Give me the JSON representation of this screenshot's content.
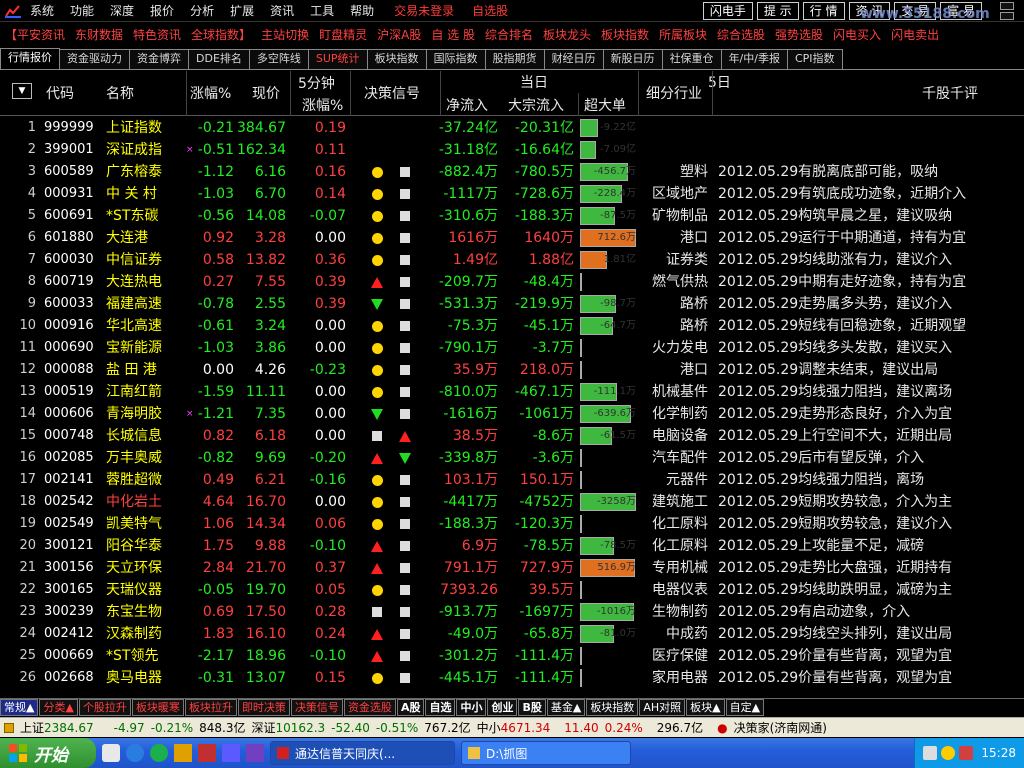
{
  "menu": {
    "items": [
      "系统",
      "功能",
      "深度",
      "报价",
      "分析",
      "扩展",
      "资讯",
      "工具",
      "帮助"
    ],
    "status_left": "交易未登录",
    "status_right": "自选股",
    "buttons": [
      "闪电手",
      "提 示",
      "行 情",
      "资 讯",
      "交 易",
      "富 易"
    ],
    "watermark": "www.55188.com"
  },
  "funcbar": [
    "【平安资讯",
    "东财数据",
    "特色资讯",
    "全球指数】",
    "主站切换",
    "盯盘精灵",
    "沪深A股",
    "自 选 股",
    "综合排名",
    "板块龙头",
    "板块指数",
    "所属板块",
    "综合选股",
    "强势选股",
    "闪电买入",
    "闪电卖出"
  ],
  "tabs": [
    "行情报价",
    "资金驱动力",
    "资金博弈",
    "DDE排名",
    "多空阵线",
    "SUP统计",
    "板块指数",
    "国际指数",
    "股指期货",
    "财经日历",
    "新股日历",
    "社保重仓",
    "年/中/季报",
    "CPI指数"
  ],
  "header": {
    "code": "代码",
    "name": "名称",
    "change": "涨幅%",
    "price": "现价",
    "five_top": "5分钟",
    "five_bottom": "涨幅%",
    "signal": "决策信号",
    "today": "当日",
    "inflow": "净流入",
    "block": "大宗流入",
    "big": "超大单",
    "industry": "细分行业",
    "five_day": "5日",
    "comment": "千股千评"
  },
  "rows": [
    {
      "idx": "1",
      "code": "999999",
      "name": "上证指数",
      "mark": "",
      "chg": "-0.21",
      "cdir": "down",
      "price": "384.67",
      "pdir": "down",
      "five": "0.19",
      "fdir": "up",
      "sig1": "",
      "sig2": "",
      "inflow": "-37.24亿",
      "idir": "down",
      "block": "-20.31亿",
      "bdir": "down",
      "big": "-9.22亿",
      "big_value": -9.22,
      "bcolor": "green",
      "ind": "",
      "comment": ""
    },
    {
      "idx": "2",
      "code": "399001",
      "name": "深证成指",
      "mark": "×",
      "chg": "-0.51",
      "cdir": "down",
      "price": "162.34",
      "pdir": "down",
      "five": "0.11",
      "fdir": "up",
      "sig1": "",
      "sig2": "",
      "inflow": "-31.18亿",
      "idir": "down",
      "block": "-16.64亿",
      "bdir": "down",
      "big": "-7.09亿",
      "big_value": -7.09,
      "bcolor": "green",
      "ind": "",
      "comment": ""
    },
    {
      "idx": "3",
      "code": "600589",
      "name": "广东榕泰",
      "mark": "",
      "chg": "-1.12",
      "cdir": "down",
      "price": "6.16",
      "pdir": "down",
      "five": "0.16",
      "fdir": "up",
      "sig1": "dot",
      "sig2": "sq",
      "inflow": "-882.4万",
      "idir": "down",
      "block": "-780.5万",
      "bdir": "down",
      "big": "-456.7万",
      "big_value": -456.7,
      "bcolor": "green",
      "ind": "塑料",
      "comment": "2012.05.29有脱离底部可能，吸纳"
    },
    {
      "idx": "4",
      "code": "000931",
      "name": "中 关 村",
      "mark": "",
      "chg": "-1.03",
      "cdir": "down",
      "price": "6.70",
      "pdir": "down",
      "five": "0.14",
      "fdir": "up",
      "sig1": "dot",
      "sig2": "sq",
      "inflow": "-1117万",
      "idir": "down",
      "block": "-728.6万",
      "bdir": "down",
      "big": "-228.4万",
      "big_value": -228.4,
      "bcolor": "green",
      "ind": "区域地产",
      "comment": "2012.05.29有筑底成功迹象，近期介入"
    },
    {
      "idx": "5",
      "code": "600691",
      "name": "*ST东碳",
      "mark": "",
      "chg": "-0.56",
      "cdir": "down",
      "price": "14.08",
      "pdir": "down",
      "five": "-0.07",
      "fdir": "down",
      "sig1": "dot",
      "sig2": "sq",
      "inflow": "-310.6万",
      "idir": "down",
      "block": "-188.3万",
      "bdir": "down",
      "big": "-87.5万",
      "big_value": -87.5,
      "bcolor": "green",
      "ind": "矿物制品",
      "comment": "2012.05.29构筑早晨之星，建议吸纳"
    },
    {
      "idx": "6",
      "code": "601880",
      "name": "大连港",
      "mark": "",
      "chg": "0.92",
      "cdir": "up",
      "price": "3.28",
      "pdir": "up",
      "five": "0.00",
      "fdir": "flat",
      "sig1": "dot",
      "sig2": "sq",
      "inflow": "1616万",
      "idir": "up",
      "block": "1640万",
      "bdir": "up",
      "big": "712.6万",
      "big_value": 712.6,
      "bcolor": "orange",
      "ind": "港口",
      "comment": "2012.05.29运行于中期通道，持有为宜"
    },
    {
      "idx": "7",
      "code": "600030",
      "name": "中信证券",
      "mark": "",
      "chg": "0.58",
      "cdir": "up",
      "price": "13.82",
      "pdir": "up",
      "five": "0.36",
      "fdir": "up",
      "sig1": "dot",
      "sig2": "sq",
      "inflow": "1.49亿",
      "idir": "up",
      "block": "1.88亿",
      "bdir": "up",
      "big": "1.81亿",
      "big_value": 1.81,
      "bcolor": "orange",
      "ind": "证券类",
      "comment": "2012.05.29均线助涨有力，建议介入"
    },
    {
      "idx": "8",
      "code": "600719",
      "name": "大连热电",
      "mark": "",
      "chg": "0.27",
      "cdir": "up",
      "price": "7.55",
      "pdir": "up",
      "five": "0.39",
      "fdir": "up",
      "sig1": "up",
      "sig2": "sq",
      "inflow": "-209.7万",
      "idir": "down",
      "block": "-48.4万",
      "bdir": "down",
      "big": "",
      "big_value": 0,
      "bcolor": "gray",
      "ind": "燃气供热",
      "comment": "2012.05.29中期有走好迹象，持有为宜"
    },
    {
      "idx": "9",
      "code": "600033",
      "name": "福建高速",
      "mark": "",
      "chg": "-0.78",
      "cdir": "down",
      "price": "2.55",
      "pdir": "down",
      "five": "0.39",
      "fdir": "up",
      "sig1": "down",
      "sig2": "sq",
      "inflow": "-531.3万",
      "idir": "down",
      "block": "-219.9万",
      "bdir": "down",
      "big": "-98.7万",
      "big_value": -98.7,
      "bcolor": "green",
      "ind": "路桥",
      "comment": "2012.05.29走势属多头势，建议介入"
    },
    {
      "idx": "10",
      "code": "000916",
      "name": "华北高速",
      "mark": "",
      "chg": "-0.61",
      "cdir": "down",
      "price": "3.24",
      "pdir": "down",
      "five": "0.00",
      "fdir": "flat",
      "sig1": "dot",
      "sig2": "sq",
      "inflow": "-75.3万",
      "idir": "down",
      "block": "-45.1万",
      "bdir": "down",
      "big": "-64.7万",
      "big_value": -64.7,
      "bcolor": "green",
      "ind": "路桥",
      "comment": "2012.05.29短线有回稳迹象，近期观望"
    },
    {
      "idx": "11",
      "code": "000690",
      "name": "宝新能源",
      "mark": "",
      "chg": "-1.03",
      "cdir": "down",
      "price": "3.86",
      "pdir": "down",
      "five": "0.00",
      "fdir": "flat",
      "sig1": "dot",
      "sig2": "sq",
      "inflow": "-790.1万",
      "idir": "down",
      "block": "-3.7万",
      "bdir": "down",
      "big": "",
      "big_value": 0,
      "bcolor": "gray",
      "ind": "火力发电",
      "comment": "2012.05.29均线多头发散，建议买入"
    },
    {
      "idx": "12",
      "code": "000088",
      "name": "盐 田 港",
      "mark": "",
      "chg": "0.00",
      "cdir": "flat",
      "price": "4.26",
      "pdir": "flat",
      "five": "-0.23",
      "fdir": "down",
      "sig1": "dot",
      "sig2": "sq",
      "inflow": "35.9万",
      "idir": "up",
      "block": "218.0万",
      "bdir": "up",
      "big": "",
      "big_value": 0,
      "bcolor": "gray",
      "ind": "港口",
      "comment": "2012.05.29调整未结束，建议出局"
    },
    {
      "idx": "13",
      "code": "000519",
      "name": "江南红箭",
      "mark": "",
      "chg": "-1.59",
      "cdir": "down",
      "price": "11.11",
      "pdir": "down",
      "five": "0.00",
      "fdir": "flat",
      "sig1": "dot",
      "sig2": "sq",
      "inflow": "-810.0万",
      "idir": "down",
      "block": "-467.1万",
      "bdir": "down",
      "big": "-111.1万",
      "big_value": -111.1,
      "bcolor": "green",
      "ind": "机械基件",
      "comment": "2012.05.29均线强力阻挡，建议离场"
    },
    {
      "idx": "14",
      "code": "000606",
      "name": "青海明胶",
      "mark": "×",
      "chg": "-1.21",
      "cdir": "down",
      "price": "7.35",
      "pdir": "down",
      "five": "0.00",
      "fdir": "flat",
      "sig1": "down",
      "sig2": "sq",
      "inflow": "-1616万",
      "idir": "down",
      "block": "-1061万",
      "bdir": "down",
      "big": "-639.6万",
      "big_value": -639.6,
      "bcolor": "green",
      "ind": "化学制药",
      "comment": "2012.05.29走势形态良好，介入为宜"
    },
    {
      "idx": "15",
      "code": "000748",
      "name": "长城信息",
      "mark": "",
      "chg": "0.82",
      "cdir": "up",
      "price": "6.18",
      "pdir": "up",
      "five": "0.00",
      "fdir": "flat",
      "sig1": "sq",
      "sig2": "up",
      "inflow": "38.5万",
      "idir": "up",
      "block": "-8.6万",
      "bdir": "down",
      "big": "-61.5万",
      "big_value": -61.5,
      "bcolor": "green",
      "ind": "电脑设备",
      "comment": "2012.05.29上行空间不大，近期出局"
    },
    {
      "idx": "16",
      "code": "002085",
      "name": "万丰奥威",
      "mark": "",
      "chg": "-0.82",
      "cdir": "down",
      "price": "9.69",
      "pdir": "down",
      "five": "-0.20",
      "fdir": "down",
      "sig1": "up",
      "sig2": "down",
      "inflow": "-339.8万",
      "idir": "down",
      "block": "-3.6万",
      "bdir": "down",
      "big": "",
      "big_value": 0,
      "bcolor": "gray",
      "ind": "汽车配件",
      "comment": "2012.05.29后市有望反弹，介入"
    },
    {
      "idx": "17",
      "code": "002141",
      "name": "蓉胜超微",
      "mark": "",
      "chg": "0.49",
      "cdir": "up",
      "price": "6.21",
      "pdir": "up",
      "five": "-0.16",
      "fdir": "down",
      "sig1": "dot",
      "sig2": "sq",
      "inflow": "103.1万",
      "idir": "up",
      "block": "150.1万",
      "bdir": "up",
      "big": "",
      "big_value": 0,
      "bcolor": "gray",
      "ind": "元器件",
      "comment": "2012.05.29均线强力阻挡，离场"
    },
    {
      "idx": "18",
      "code": "002542",
      "name": "中化岩土",
      "mark": "",
      "namered": true,
      "chg": "4.64",
      "cdir": "up",
      "price": "16.70",
      "pdir": "up",
      "five": "0.00",
      "fdir": "flat",
      "sig1": "dot",
      "sig2": "sq",
      "inflow": "-4417万",
      "idir": "down",
      "block": "-4752万",
      "bdir": "down",
      "big": "-3258万",
      "big_value": -3258,
      "bcolor": "green",
      "ind": "建筑施工",
      "comment": "2012.05.29短期攻势较急，介入为主"
    },
    {
      "idx": "19",
      "code": "002549",
      "name": "凯美特气",
      "mark": "",
      "chg": "1.06",
      "cdir": "up",
      "price": "14.34",
      "pdir": "up",
      "five": "0.06",
      "fdir": "up",
      "sig1": "dot",
      "sig2": "sq",
      "inflow": "-188.3万",
      "idir": "down",
      "block": "-120.3万",
      "bdir": "down",
      "big": "",
      "big_value": 0,
      "bcolor": "gray",
      "ind": "化工原料",
      "comment": "2012.05.29短期攻势较急，建议介入"
    },
    {
      "idx": "20",
      "code": "300121",
      "name": "阳谷华泰",
      "mark": "",
      "chg": "1.75",
      "cdir": "up",
      "price": "9.88",
      "pdir": "up",
      "five": "-0.10",
      "fdir": "down",
      "sig1": "up",
      "sig2": "sq",
      "inflow": "6.9万",
      "idir": "up",
      "block": "-78.5万",
      "bdir": "down",
      "big": "-78.5万",
      "big_value": -78.5,
      "bcolor": "green",
      "ind": "化工原料",
      "comment": "2012.05.29上攻能量不足，减磅"
    },
    {
      "idx": "21",
      "code": "300156",
      "name": "天立环保",
      "mark": "",
      "chg": "2.84",
      "cdir": "up",
      "price": "21.70",
      "pdir": "up",
      "five": "0.37",
      "fdir": "up",
      "sig1": "up",
      "sig2": "sq",
      "inflow": "791.1万",
      "idir": "up",
      "block": "727.9万",
      "bdir": "up",
      "big": "516.9万",
      "big_value": 516.9,
      "bcolor": "orange",
      "ind": "专用机械",
      "comment": "2012.05.29走势比大盘强，近期持有"
    },
    {
      "idx": "22",
      "code": "300165",
      "name": "天瑞仪器",
      "mark": "",
      "chg": "-0.05",
      "cdir": "down",
      "price": "19.70",
      "pdir": "down",
      "five": "0.05",
      "fdir": "up",
      "sig1": "dot",
      "sig2": "sq",
      "inflow": "7393.26",
      "idir": "up",
      "block": "39.5万",
      "bdir": "up",
      "big": "",
      "big_value": 0,
      "bcolor": "gray",
      "ind": "电器仪表",
      "comment": "2012.05.29均线助跌明显，减磅为主"
    },
    {
      "idx": "23",
      "code": "300239",
      "name": "东宝生物",
      "mark": "",
      "chg": "0.69",
      "cdir": "up",
      "price": "17.50",
      "pdir": "up",
      "five": "0.28",
      "fdir": "up",
      "sig1": "sq",
      "sig2": "sq",
      "inflow": "-913.7万",
      "idir": "down",
      "block": "-1697万",
      "bdir": "down",
      "big": "-1016万",
      "big_value": -1016,
      "bcolor": "green",
      "ind": "生物制药",
      "comment": "2012.05.29有启动迹象，介入"
    },
    {
      "idx": "24",
      "code": "002412",
      "name": "汉森制药",
      "mark": "",
      "chg": "1.83",
      "cdir": "up",
      "price": "16.10",
      "pdir": "up",
      "five": "0.24",
      "fdir": "up",
      "sig1": "up",
      "sig2": "sq",
      "inflow": "-49.0万",
      "idir": "down",
      "block": "-65.8万",
      "bdir": "down",
      "big": "-81.0万",
      "big_value": -81.0,
      "bcolor": "green",
      "ind": "中成药",
      "comment": "2012.05.29均线空头排列，建议出局"
    },
    {
      "idx": "25",
      "code": "000669",
      "name": "*ST领先",
      "mark": "",
      "chg": "-2.17",
      "cdir": "down",
      "price": "18.96",
      "pdir": "down",
      "five": "-0.10",
      "fdir": "down",
      "sig1": "up",
      "sig2": "sq",
      "inflow": "-301.2万",
      "idir": "down",
      "block": "-111.4万",
      "bdir": "down",
      "big": "",
      "big_value": 0,
      "bcolor": "gray",
      "ind": "医疗保健",
      "comment": "2012.05.29价量有些背离，观望为宜"
    },
    {
      "idx": "26",
      "code": "002668",
      "name": "奥马电器",
      "mark": "",
      "chg": "-0.31",
      "cdir": "down",
      "price": "13.07",
      "pdir": "down",
      "five": "0.15",
      "fdir": "up",
      "sig1": "dot",
      "sig2": "sq",
      "inflow": "-445.1万",
      "idir": "down",
      "block": "-111.4万",
      "bdir": "down",
      "big": "",
      "big_value": 0,
      "bcolor": "gray",
      "ind": "家用电器",
      "comment": "2012.05.29价量有些背离，观望为宜"
    }
  ],
  "bottom_tabs": [
    "常规▲",
    "分类▲",
    "个股拉升",
    "板块暖寒",
    "板块拉升",
    "即时决策",
    "决策信号",
    "资金选股",
    "A股",
    "自选",
    "中小",
    "创业",
    "B股",
    "基金▲",
    "板块指数",
    "AH对照",
    "板块▲",
    "自定▲"
  ],
  "status": {
    "sh_label": "上证",
    "sh_val": "2384.67",
    "sh_chg": "-4.97",
    "sh_pct": "-0.21%",
    "sh_amt": "848.3亿",
    "sz_label": "深证",
    "sz_val": "10162.3",
    "sz_chg": "-52.40",
    "sz_pct": "-0.51%",
    "sz_amt": "767.2亿",
    "sm_label": "中小",
    "sm_val": "4671.34",
    "sm_chg": "11.40",
    "sm_pct": "0.24%",
    "sm_amt": "296.7亿",
    "right": "决策家(济南网通)"
  },
  "taskbar": {
    "start": "开始",
    "tasks": [
      "通达信普天同庆(...",
      "D:\\抓图"
    ],
    "clock": "15:28"
  }
}
